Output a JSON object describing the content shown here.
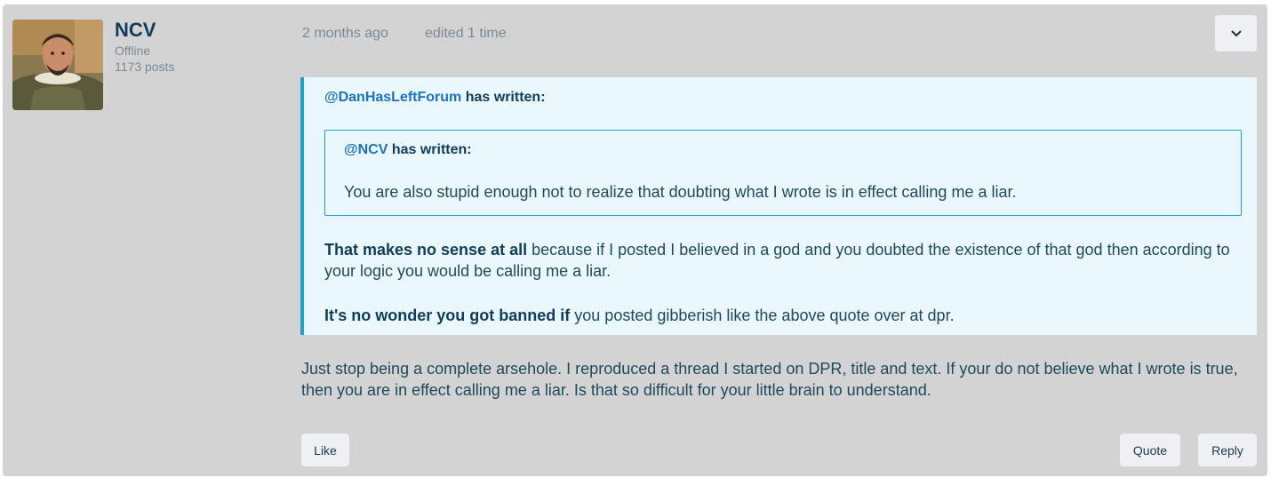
{
  "author": {
    "name": "NCV",
    "status": "Offline",
    "post_count": "1173 posts"
  },
  "meta": {
    "timestamp": "2 months ago",
    "edited": "edited 1 time"
  },
  "icons": {
    "menu": "chevron-down-icon"
  },
  "quote": {
    "mention": "@DanHasLeftForum",
    "has_written": "has written:",
    "nested": {
      "mention": "@NCV",
      "has_written": "has written:",
      "text": "You are also stupid enough not to realize that doubting what I wrote is in effect calling me a liar."
    },
    "para1_bold": "That makes no sense at all",
    "para1_rest": " because if I posted I believed in a god and you doubted the existence of that god then according to your logic you would be calling me a liar.",
    "para2_bold": "It's no wonder you got banned if",
    "para2_rest": " you posted gibberish like the above quote over at dpr."
  },
  "body": "Just stop being a complete arsehole. I reproduced a thread I started on DPR, title and text. If your do not believe what I wrote is true, then you are in effect calling me a liar. Is that so difficult for your little brain to understand.",
  "actions": {
    "like": "Like",
    "quote": "Quote",
    "reply": "Reply"
  },
  "colors": {
    "post_bg": "#d3d3d3",
    "quote_bg": "#eaf7fd",
    "quote_border": "#1aa3cf",
    "mention": "#1a73c8",
    "button_bg": "#eef0f3"
  }
}
